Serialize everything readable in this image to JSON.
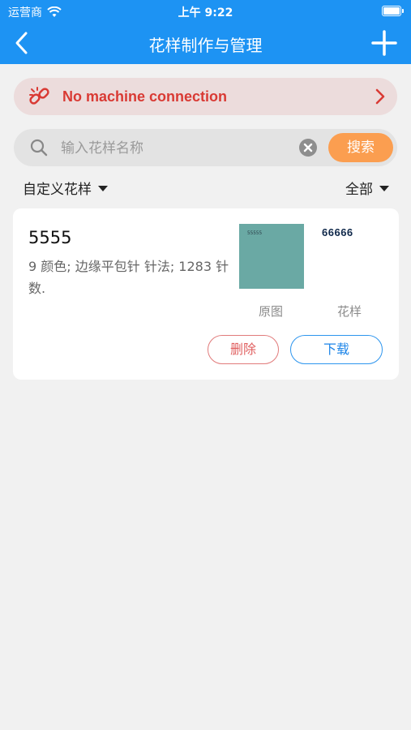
{
  "status_bar": {
    "carrier": "运营商",
    "time": "上午 9:22"
  },
  "header": {
    "title": "花样制作与管理"
  },
  "banner": {
    "text": "No machine connection"
  },
  "search": {
    "placeholder": "输入花样名称",
    "value": "",
    "button_label": "搜索"
  },
  "filters": {
    "left": "自定义花样",
    "right": "全部"
  },
  "patterns": [
    {
      "name": "5555",
      "description": "9 颜色; 边缘平包针 针法; 1283 针数.",
      "original_thumb_text": "55555",
      "pattern_thumb_text": "66666",
      "original_label": "原图",
      "pattern_label": "花样",
      "delete_label": "删除",
      "download_label": "下载"
    }
  ],
  "colors": {
    "header": "#1d93f3",
    "alert_text": "#d93a34",
    "search_button": "#fb9e50",
    "download": "#1d85e8",
    "delete": "#e06060"
  }
}
